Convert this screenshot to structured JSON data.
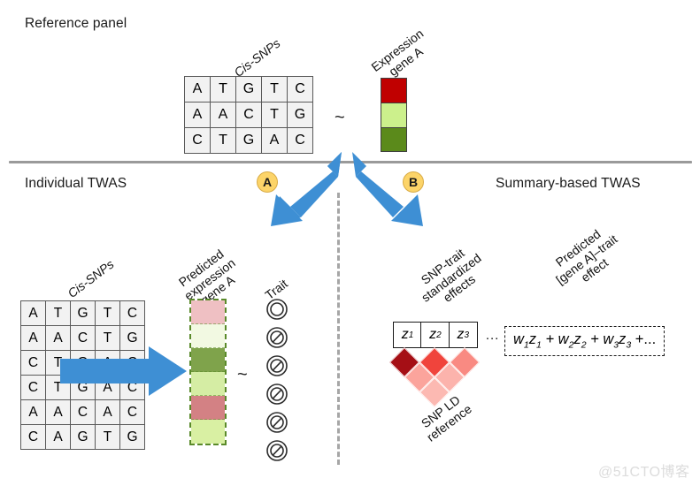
{
  "figure": {
    "watermark": "@51CTO博客"
  },
  "top_section": {
    "title": "Reference panel",
    "genotype_label": "Cis-SNPs",
    "genotype_matrix": {
      "rows": [
        [
          "A",
          "T",
          "G",
          "T",
          "C"
        ],
        [
          "A",
          "A",
          "C",
          "T",
          "G"
        ],
        [
          "C",
          "T",
          "G",
          "A",
          "C"
        ]
      ]
    },
    "relation_symbol": "~",
    "expression_label_lines": [
      "Expression",
      "gene A"
    ],
    "expression_cells": [
      {
        "color": "#c00000"
      },
      {
        "color": "#ccf08c"
      },
      {
        "color": "#5b8a1b"
      }
    ]
  },
  "branches": {
    "a_badge": "A",
    "b_badge": "B"
  },
  "left_section": {
    "title": "Individual TWAS",
    "genotype_label": "Cis-SNPs",
    "genotype_matrix": {
      "rows": [
        [
          "A",
          "T",
          "G",
          "T",
          "C"
        ],
        [
          "A",
          "A",
          "C",
          "T",
          "G"
        ],
        [
          "C",
          "T",
          "G",
          "A",
          "C"
        ],
        [
          "C",
          "T",
          "G",
          "A",
          "C"
        ],
        [
          "A",
          "A",
          "C",
          "A",
          "C"
        ],
        [
          "C",
          "A",
          "G",
          "T",
          "G"
        ]
      ]
    },
    "predicted_label_lines": [
      "Predicted",
      "expression",
      "gene A"
    ],
    "predicted_cells": [
      {
        "color": "#efc0c3"
      },
      {
        "color": "#f2f9e2"
      },
      {
        "color": "#7fa34b"
      },
      {
        "color": "#d5eda4"
      },
      {
        "color": "#d38184"
      },
      {
        "color": "#d9f0a3"
      }
    ],
    "relation_symbol": "~",
    "trait_label": "Trait",
    "trait_icons": [
      "circle-ring-icon",
      "circle-slash-icon",
      "circle-slash-icon",
      "circle-slash-icon",
      "circle-slash-icon",
      "circle-slash-icon"
    ]
  },
  "right_section": {
    "title": "Summary-based TWAS",
    "effects_label_lines": [
      "SNP-trait",
      "standardized",
      "effects"
    ],
    "z_vector": [
      "z",
      "z",
      "z"
    ],
    "z_subscripts": [
      "1",
      "2",
      "3"
    ],
    "z_ellipsis": "...",
    "ld_label_lines": [
      "SNP LD",
      "reference"
    ],
    "ld_colors": [
      [
        "#a50f15",
        "#f0443c",
        "#f98a82"
      ],
      [
        "#fba49c",
        "#fcb3ac"
      ],
      [
        "#fcb9b2"
      ]
    ],
    "predicted_effect_label_lines": [
      "Predicted",
      "[gene A]–trait",
      "effect"
    ],
    "formula_terms": [
      {
        "w": "w",
        "wsub": "1",
        "z": "z",
        "zsub": "1"
      },
      {
        "w": "w",
        "wsub": "2",
        "z": "z",
        "zsub": "2"
      },
      {
        "w": "w",
        "wsub": "3",
        "z": "z",
        "zsub": "3"
      }
    ],
    "formula_plus": "+",
    "formula_tail": "+..."
  },
  "colors": {
    "arrow_blue": "#3e8fd4",
    "badge_gold": "#fcd469",
    "divider_gray": "#9a9a9a",
    "dashed_green": "#5a8a2a"
  }
}
